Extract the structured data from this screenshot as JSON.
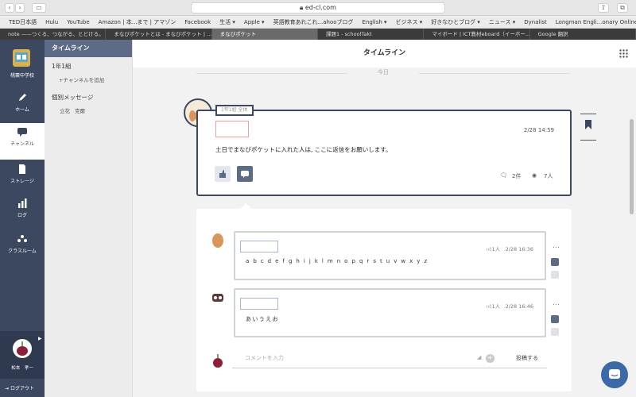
{
  "browser": {
    "url": "ed-cl.com",
    "bookmarks": [
      "TED日本語",
      "Hulu",
      "YouTube",
      "Amazon | 本...まで | アマゾン",
      "Facebook",
      "生活 ▾",
      "Apple ▾",
      "英語教育あれこれ...ahooブログ",
      "English ▾",
      "ビジネス ▾",
      "好きなひとブログ ▾",
      "ニュース ▾",
      "Dynalist",
      "Longman Engli...onary Online"
    ],
    "tabs": [
      {
        "label": "note ——つくる、つながる、とどける。",
        "active": false
      },
      {
        "label": "まなびポケットとは - まなびポケット | ...",
        "active": false
      },
      {
        "label": "まなびポケット",
        "active": true
      },
      {
        "label": "課題1 - schoolTakt",
        "active": false
      },
      {
        "label": "マイボード | ICT教材eboard（イーボー...",
        "active": false
      },
      {
        "label": "Google 翻訳",
        "active": false
      }
    ]
  },
  "sidebar": {
    "school_name": "桃粟中学校",
    "items": [
      {
        "label": "ホーム",
        "icon": "pencil-icon"
      },
      {
        "label": "チャンネル",
        "icon": "chat-icon"
      },
      {
        "label": "ストレージ",
        "icon": "file-icon"
      },
      {
        "label": "ログ",
        "icon": "bar-chart-icon"
      },
      {
        "label": "クラスルーム",
        "icon": "classroom-icon"
      }
    ],
    "user_name": "松本　孝一",
    "logout_label": "ログアウト"
  },
  "subpanel": {
    "header": "タイムライン",
    "group": "1年1組",
    "add_channel": "チャンネルを追加",
    "dm_header": "個別メッセージ",
    "dm_names": [
      "立花",
      "克爾"
    ]
  },
  "main": {
    "title": "タイムライン",
    "today": "今日",
    "post": {
      "class_label": "1年1組 全体",
      "time": "2/28 14:59",
      "body": "土日でまなびポケットに入れた人は, ここに返信をお願いします。",
      "comment_count": "2件",
      "view_count": "7人"
    },
    "comments": [
      {
        "likes": "1人",
        "time": "2/28 16:36",
        "text": "a b c d e f g h i j k l m n o p q r s t u v w x y z"
      },
      {
        "likes": "1人",
        "time": "2/28 16:46",
        "text": "あいうえお"
      }
    ],
    "comment_placeholder": "コメントを入力",
    "post_button": "投稿する"
  }
}
